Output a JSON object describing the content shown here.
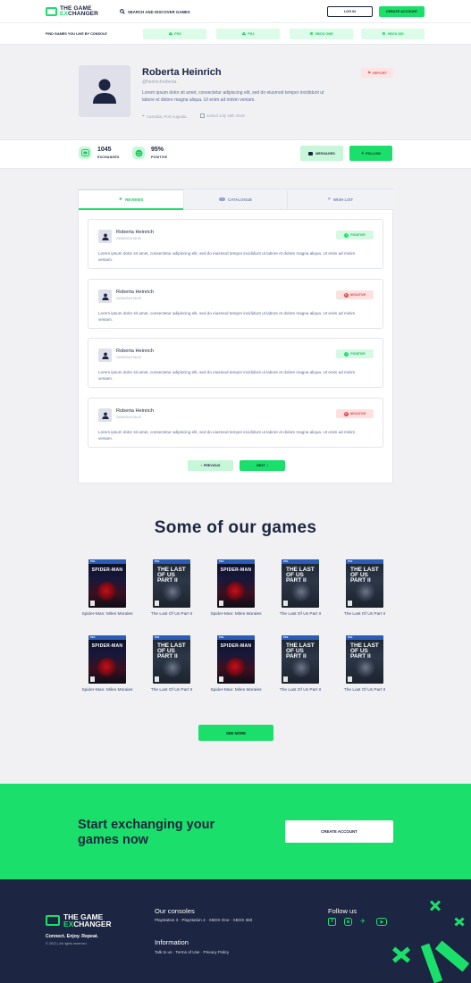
{
  "brand": {
    "line1": "THE GAME",
    "line2_prefix": "EX",
    "line2_rest": "CHANGER",
    "accent": "#1ae06b",
    "navy": "#1c2541"
  },
  "header": {
    "search_label": "SEARCH AND DISCOVER GAMES",
    "login_label": "LOG IN",
    "create_account_label": "CREATE ACCOUNT"
  },
  "consoles_bar": {
    "label": "FIND GAMES YOU LIKE BY CONSOLE",
    "chips": [
      {
        "icon": "playstation-icon",
        "label": "PS5"
      },
      {
        "icon": "playstation-icon",
        "label": "PS4"
      },
      {
        "icon": "xbox-icon",
        "label": "XBOX ONE"
      },
      {
        "icon": "xbox-icon",
        "label": "XBOX 360"
      }
    ]
  },
  "profile": {
    "name": "Roberta Heinrich",
    "handle": "@heinrichroberta",
    "bio": "Lorem ipsum dolor sit amet, consectetur adipiscing elit, sed do eiusmod tempor incididunt ut labore et dolore magna aliqua. Ut enim ad minim veniam.",
    "location": "Australia, Port Augusta",
    "joined": "Joined July 16th 2019",
    "report_label": "REPORT"
  },
  "stats": {
    "exchanges_value": "1045",
    "exchanges_label": "EXCHANGES",
    "positive_value": "95%",
    "positive_label": "POSITIVE",
    "messages_label": "MESSAGES",
    "follow_label": "FOLLOW"
  },
  "tabs": [
    {
      "label": "REVIEWS",
      "icon": "star-icon",
      "active": true
    },
    {
      "label": "CATALOGUE",
      "icon": "gamepad-icon",
      "active": false
    },
    {
      "label": "WISH LIST",
      "icon": "heart-icon",
      "active": false
    }
  ],
  "reviews": [
    {
      "name": "Roberta Heinrich",
      "date": "24/06/2019 06:20",
      "status": "POSITIVE",
      "text": "Lorem ipsum dolor sit amet, consectetur adipiscing elit, sed do eiusmod tempor incididunt ut labore et dolore magna aliqua. Ut enim ad minim veniam."
    },
    {
      "name": "Roberta Heinrich",
      "date": "24/06/2019 06:20",
      "status": "NEGATIVE",
      "text": "Lorem ipsum dolor sit amet, consectetur adipiscing elit, sed do eiusmod tempor incididunt ut labore et dolore magna aliqua. Ut enim ad minim veniam."
    },
    {
      "name": "Roberta Heinrich",
      "date": "24/06/2019 06:20",
      "status": "POSITIVE",
      "text": "Lorem ipsum dolor sit amet, consectetur adipiscing elit, sed do eiusmod tempor incididunt ut labore et dolore magna aliqua. Ut enim ad minim veniam."
    },
    {
      "name": "Roberta Heinrich",
      "date": "24/06/2019 06:20",
      "status": "NEGATIVE",
      "text": "Lorem ipsum dolor sit amet, consectetur adipiscing elit, sed do eiusmod tempor incididunt ut labore et dolore magna aliqua. Ut enim ad minim veniam."
    }
  ],
  "pagination": {
    "prev_label": "PREVIOUS",
    "next_label": "NEXT"
  },
  "games_section": {
    "title": "Some of our games",
    "see_more_label": "SEE MORE",
    "games": [
      {
        "name": "Spider-Man: Miles Morales",
        "cover": "spider",
        "platform": "PS4",
        "cover_title": "SPIDER-MAN"
      },
      {
        "name": "The Last Of Us Part II",
        "cover": "tlou",
        "platform": "PS4",
        "cover_title": "THE LAST OF US PART II"
      },
      {
        "name": "Spider-Man: Miles Morales",
        "cover": "spider",
        "platform": "PS4",
        "cover_title": "SPIDER-MAN"
      },
      {
        "name": "The Last Of Us Part II",
        "cover": "tlou",
        "platform": "PS4",
        "cover_title": "THE LAST OF US PART II"
      },
      {
        "name": "The Last Of Us Part II",
        "cover": "tlou",
        "platform": "PS4",
        "cover_title": "THE LAST OF US PART II"
      },
      {
        "name": "Spider-Man: Miles Morales",
        "cover": "spider",
        "platform": "PS4",
        "cover_title": "SPIDER-MAN"
      },
      {
        "name": "The Last Of Us Part II",
        "cover": "tlou",
        "platform": "PS4",
        "cover_title": "THE LAST OF US PART II"
      },
      {
        "name": "Spider-Man: Miles Morales",
        "cover": "spider",
        "platform": "PS4",
        "cover_title": "SPIDER-MAN"
      },
      {
        "name": "The Last Of Us Part II",
        "cover": "tlou",
        "platform": "PS4",
        "cover_title": "THE LAST OF US PART II"
      },
      {
        "name": "The Last Of Us Part II",
        "cover": "tlou",
        "platform": "PS4",
        "cover_title": "THE LAST OF US PART II"
      }
    ]
  },
  "cta": {
    "text": "Start exchanging your games now",
    "button_label": "CREATE ACCOUNT"
  },
  "footer": {
    "tagline": "Connect. Enjoy. Repeat.",
    "copyright": "© 2021 | All rights reserved",
    "consoles_title": "Our consoles",
    "consoles_links": "Playstation 3 · Playstation 4 · XBOX One · XBOX 360",
    "info_title": "Information",
    "info_links": "Talk to us · Terms of Use · Privacy Policy",
    "follow_title": "Follow us",
    "socials": [
      "facebook-icon",
      "instagram-icon",
      "twitter-icon",
      "youtube-icon"
    ]
  }
}
